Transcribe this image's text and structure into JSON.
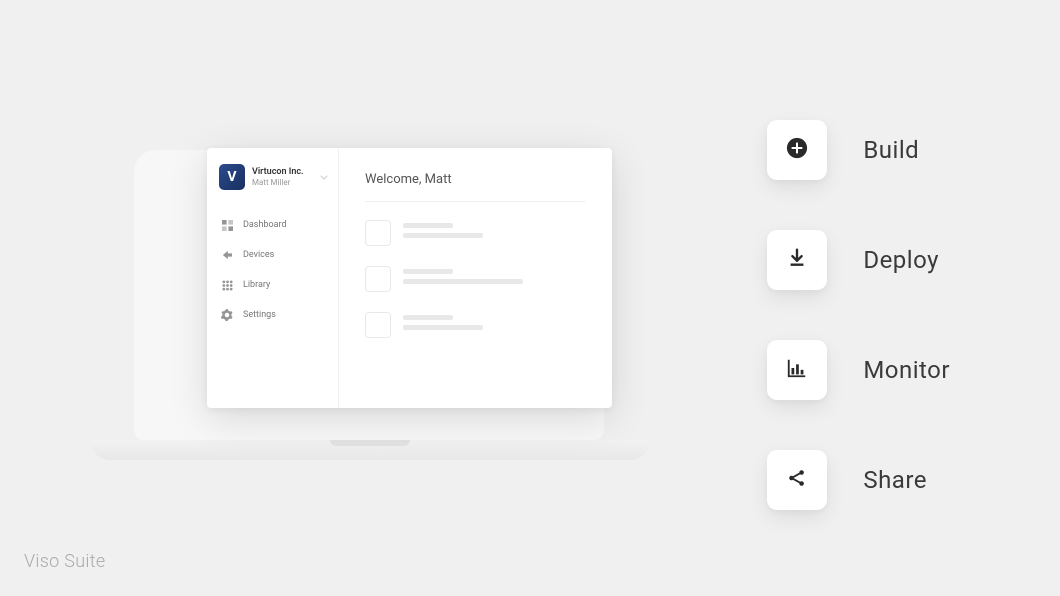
{
  "brand": "Viso Suite",
  "workspace": {
    "logo_letter": "V",
    "name": "Virtucon Inc.",
    "user": "Matt Miller"
  },
  "sidebar": {
    "items": [
      {
        "label": "Dashboard",
        "icon": "dashboard-icon"
      },
      {
        "label": "Devices",
        "icon": "devices-icon"
      },
      {
        "label": "Library",
        "icon": "library-icon"
      },
      {
        "label": "Settings",
        "icon": "settings-icon"
      }
    ]
  },
  "main": {
    "welcome": "Welcome, Matt"
  },
  "features": [
    {
      "label": "Build",
      "icon": "plus-icon"
    },
    {
      "label": "Deploy",
      "icon": "download-icon"
    },
    {
      "label": "Monitor",
      "icon": "bar-chart-icon"
    },
    {
      "label": "Share",
      "icon": "share-icon"
    }
  ]
}
